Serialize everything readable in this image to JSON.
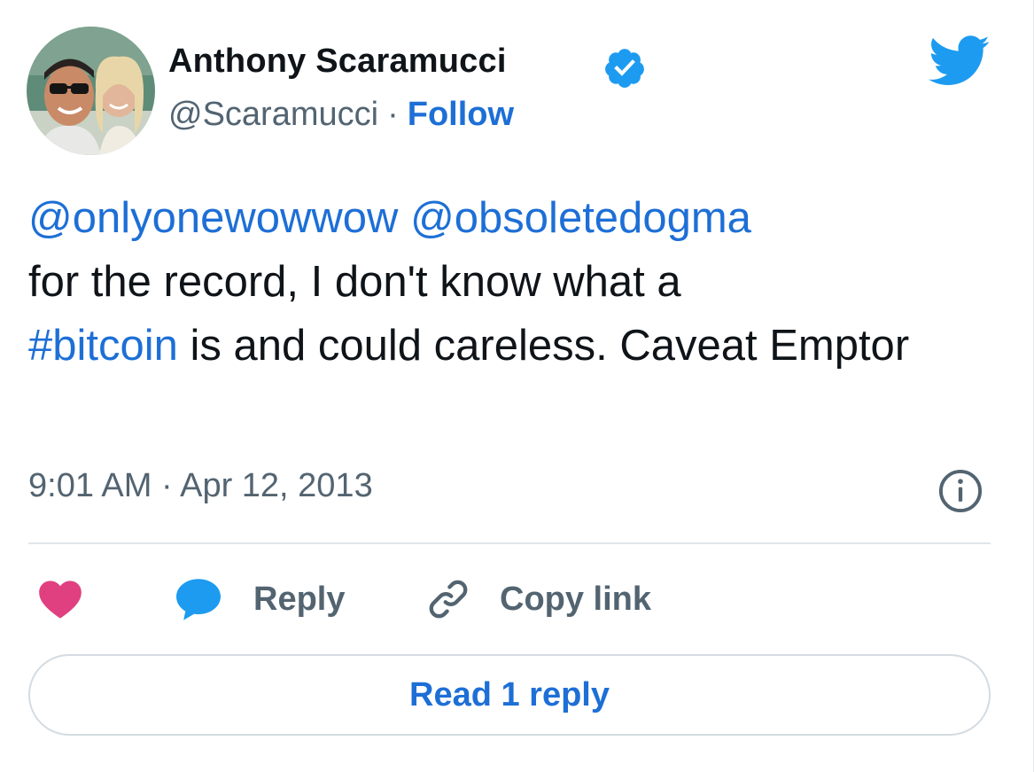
{
  "author": {
    "name": "Anthony Scaramucci",
    "handle": "@Scaramucci",
    "separator": "·",
    "follow_label": "Follow"
  },
  "tweet": {
    "mention_1": "@onlyonewowwow",
    "mention_2": "@obsoletedogma",
    "text_1": "for the record, I don't know what a",
    "hashtag": "#bitcoin",
    "text_2": " is and could careless. Caveat Emptor"
  },
  "meta": {
    "timestamp": "9:01 AM · Apr 12, 2013"
  },
  "actions": {
    "reply_label": "Reply",
    "copy_label": "Copy link",
    "read_replies_label": "Read 1 reply"
  },
  "icons": {
    "brand": "twitter-bird-icon",
    "verified": "verified-badge-icon",
    "info": "info-icon",
    "like": "heart-icon",
    "reply": "speech-bubble-icon",
    "copy": "link-icon"
  },
  "colors": {
    "link_blue": "#1d6fd6",
    "twitter_blue": "#1d9bf0",
    "heart_pink": "#e0407f",
    "muted_text": "#536471"
  }
}
